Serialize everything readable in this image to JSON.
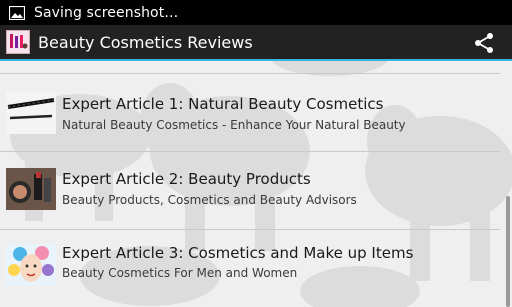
{
  "status_bar": {
    "text": "Saving screenshot…",
    "icon": "image-icon"
  },
  "action_bar": {
    "title": "Beauty Cosmetics Reviews",
    "app_icon": "app-logo-icon",
    "share_icon": "share-icon"
  },
  "articles": [
    {
      "title": "Expert Article 1: Natural Beauty Cosmetics",
      "subtitle": "Natural Beauty Cosmetics - Enhance Your Natural Beauty",
      "thumb": "eyeliner-pencil-thumbnail"
    },
    {
      "title": "Expert Article 2: Beauty Products",
      "subtitle": "Beauty Products, Cosmetics and Beauty Advisors",
      "thumb": "makeup-products-thumbnail"
    },
    {
      "title": "Expert Article 3: Cosmetics and Make up Items",
      "subtitle": "Beauty Cosmetics For Men and Women",
      "thumb": "painted-face-thumbnail"
    }
  ],
  "colors": {
    "status_bar": "#000000",
    "action_bar": "#222222",
    "accent": "#33b5e5",
    "background": "#efefef"
  }
}
